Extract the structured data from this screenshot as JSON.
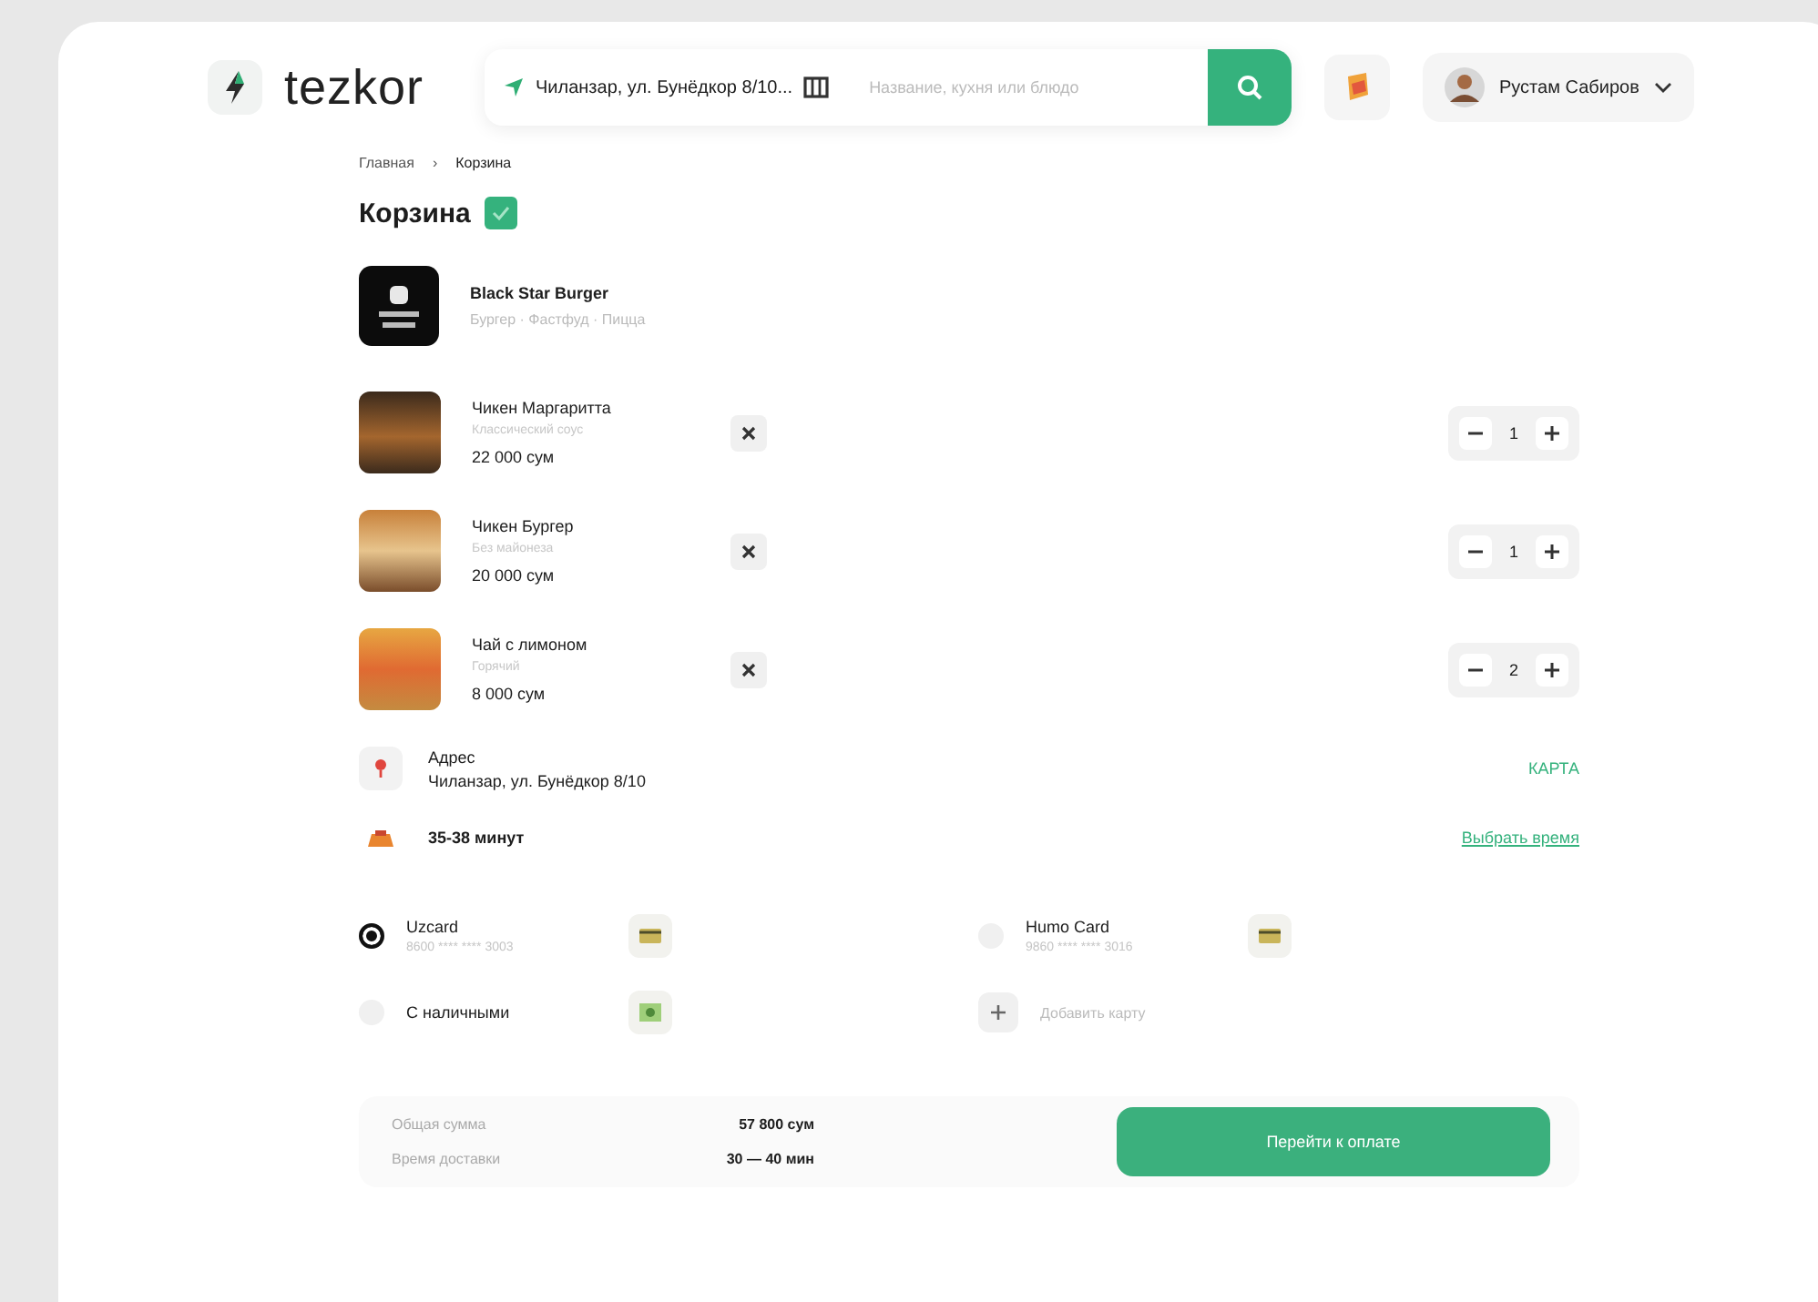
{
  "header": {
    "logo": "tezkor",
    "location": "Чиланзар, ул. Бунёдкор 8/10...",
    "search": {
      "placeholder": "Название, кухня или блюдо"
    },
    "user": "Рустам Сабиров"
  },
  "breadcrumbs": [
    "Главная",
    "Корзина"
  ],
  "breadcrumb_separator": "›",
  "title": "Корзина",
  "restaurant": {
    "name": "Black Star Burger",
    "tags": "Бургер · Фастфуд · Пицца"
  },
  "items": [
    {
      "name": "Чикен Маргаритта",
      "description": "Классический соус",
      "price": "22 000 сум",
      "quantity": "1"
    },
    {
      "name": "Чикен Бургер",
      "description": "Без майонеза",
      "price": "20 000 сум",
      "quantity": "1"
    },
    {
      "name": "Чай с лимоном",
      "description": "Горячий",
      "price": "8 000 сум",
      "quantity": "2"
    }
  ],
  "address": {
    "label": "Адрес",
    "value": "Чиланзар, ул. Бунёдкор 8/10",
    "action": "КАРТА"
  },
  "delivery_time": {
    "value": "35-38 минут",
    "action": "Выбрать время"
  },
  "payments": [
    {
      "kind": "card",
      "name": "Uzcard",
      "number": "8600 **** **** 3003",
      "selected": true
    },
    {
      "kind": "card",
      "name": "Humo Card",
      "number": "9860 **** **** 3016",
      "selected": false
    },
    {
      "kind": "cash",
      "name": "С наличными",
      "selected": false
    },
    {
      "kind": "add",
      "name": "Добавить карту"
    }
  ],
  "summary": [
    {
      "label": "Общая сумма",
      "value": "57 800 сум"
    },
    {
      "label": "Время доставки",
      "value": "30 — 40 мин"
    }
  ],
  "checkout_button": "Перейти к оплате"
}
